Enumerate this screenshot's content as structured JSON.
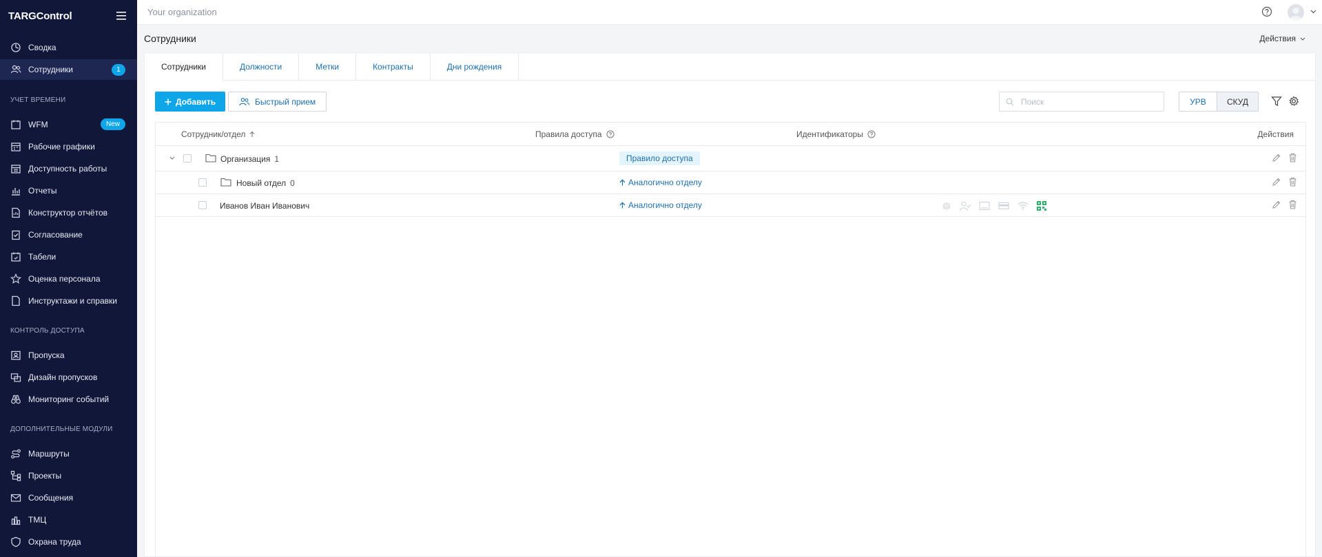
{
  "app": {
    "logo": "TARGControl",
    "organization": "Your organization"
  },
  "sidebar": {
    "items": [
      {
        "label": "Сводка",
        "icon": "dashboard-icon"
      },
      {
        "label": "Сотрудники",
        "icon": "users-icon",
        "badge": "1",
        "active": true
      }
    ],
    "sections": [
      {
        "title": "УЧЕТ ВРЕМЕНИ",
        "items": [
          {
            "label": "WFM",
            "icon": "calendar-icon",
            "badge": "New"
          },
          {
            "label": "Рабочие графики",
            "icon": "schedule-icon"
          },
          {
            "label": "Доступность работы",
            "icon": "availability-icon"
          },
          {
            "label": "Отчеты",
            "icon": "bar-chart-icon"
          },
          {
            "label": "Конструктор отчётов",
            "icon": "report-builder-icon"
          },
          {
            "label": "Согласование",
            "icon": "approval-icon"
          },
          {
            "label": "Табели",
            "icon": "timesheet-icon"
          },
          {
            "label": "Оценка персонала",
            "icon": "star-icon"
          },
          {
            "label": "Инструктажи и справки",
            "icon": "document-icon"
          }
        ]
      },
      {
        "title": "КОНТРОЛЬ ДОСТУПА",
        "items": [
          {
            "label": "Пропуска",
            "icon": "badge-icon"
          },
          {
            "label": "Дизайн пропусков",
            "icon": "badge-design-icon"
          },
          {
            "label": "Мониторинг событий",
            "icon": "binoculars-icon"
          }
        ]
      },
      {
        "title": "ДОПОЛНИТЕЛЬНЫЕ МОДУЛИ",
        "items": [
          {
            "label": "Маршруты",
            "icon": "route-icon"
          },
          {
            "label": "Проекты",
            "icon": "projects-icon"
          },
          {
            "label": "Сообщения",
            "icon": "mail-icon"
          },
          {
            "label": "ТМЦ",
            "icon": "inventory-icon"
          },
          {
            "label": "Охрана труда",
            "icon": "shield-icon"
          }
        ]
      }
    ]
  },
  "page": {
    "title": "Сотрудники",
    "actions_label": "Действия"
  },
  "tabs": [
    {
      "label": "Сотрудники",
      "active": true
    },
    {
      "label": "Должности"
    },
    {
      "label": "Метки"
    },
    {
      "label": "Контракты"
    },
    {
      "label": "Дни рождения"
    }
  ],
  "toolbar": {
    "add_label": "Добавить",
    "quick_label": "Быстрый прием",
    "search_placeholder": "Поиск",
    "segment": [
      "УРВ",
      "СКУД"
    ],
    "segment_active": "СКУД"
  },
  "table": {
    "columns": {
      "employee": "Сотрудник/отдел",
      "access": "Правила доступа",
      "identifiers": "Идентификаторы",
      "actions": "Действия"
    },
    "rows": [
      {
        "type": "org",
        "name": "Организация",
        "count": "1",
        "access": "Правило доступа"
      },
      {
        "type": "dept",
        "name": "Новый отдел",
        "count": "0",
        "access": "Аналогично отделу"
      },
      {
        "type": "person",
        "name": "Иванов Иван Иванович",
        "access": "Аналогично отделу"
      }
    ]
  },
  "colors": {
    "sidebar_bg": "#101739",
    "accent": "#0fa6e9",
    "link": "#1b6fae",
    "qr_icon": "#2fb36a"
  }
}
